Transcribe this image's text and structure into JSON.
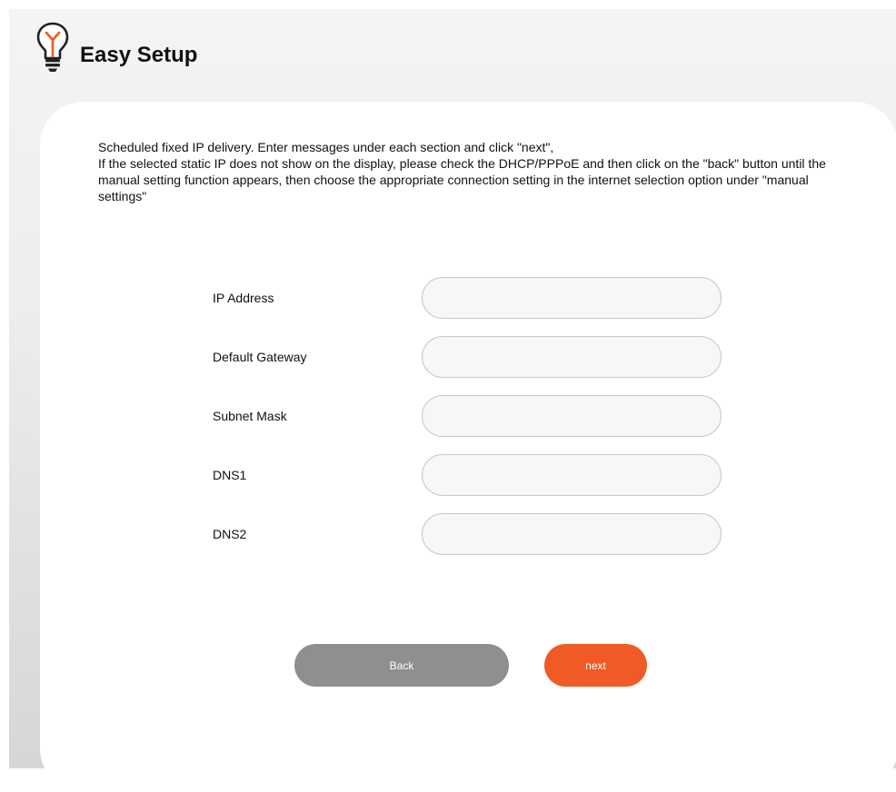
{
  "header": {
    "title": "Easy Setup",
    "icon": "lightbulb-icon"
  },
  "description": {
    "line1": "Scheduled fixed IP delivery. Enter messages under each section and click \"next\",",
    "line2": "If the selected static IP does not show on the display, please check the DHCP/PPPoE and then click on the \"back\" button until the manual setting function appears, then choose the appropriate connection setting in the internet selection option under \"manual settings\""
  },
  "fields": [
    {
      "label": "IP Address",
      "value": "",
      "placeholder": ""
    },
    {
      "label": "Default Gateway",
      "value": "",
      "placeholder": ""
    },
    {
      "label": "Subnet Mask",
      "value": "",
      "placeholder": ""
    },
    {
      "label": "DNS1",
      "value": "",
      "placeholder": ""
    },
    {
      "label": "DNS2",
      "value": "",
      "placeholder": ""
    }
  ],
  "buttons": {
    "back_label": "Back",
    "next_label": "next"
  },
  "colors": {
    "accent": "#f05a24",
    "back_button": "#8f8f8f",
    "icon_orange": "#f05a24",
    "text": "#111111"
  }
}
